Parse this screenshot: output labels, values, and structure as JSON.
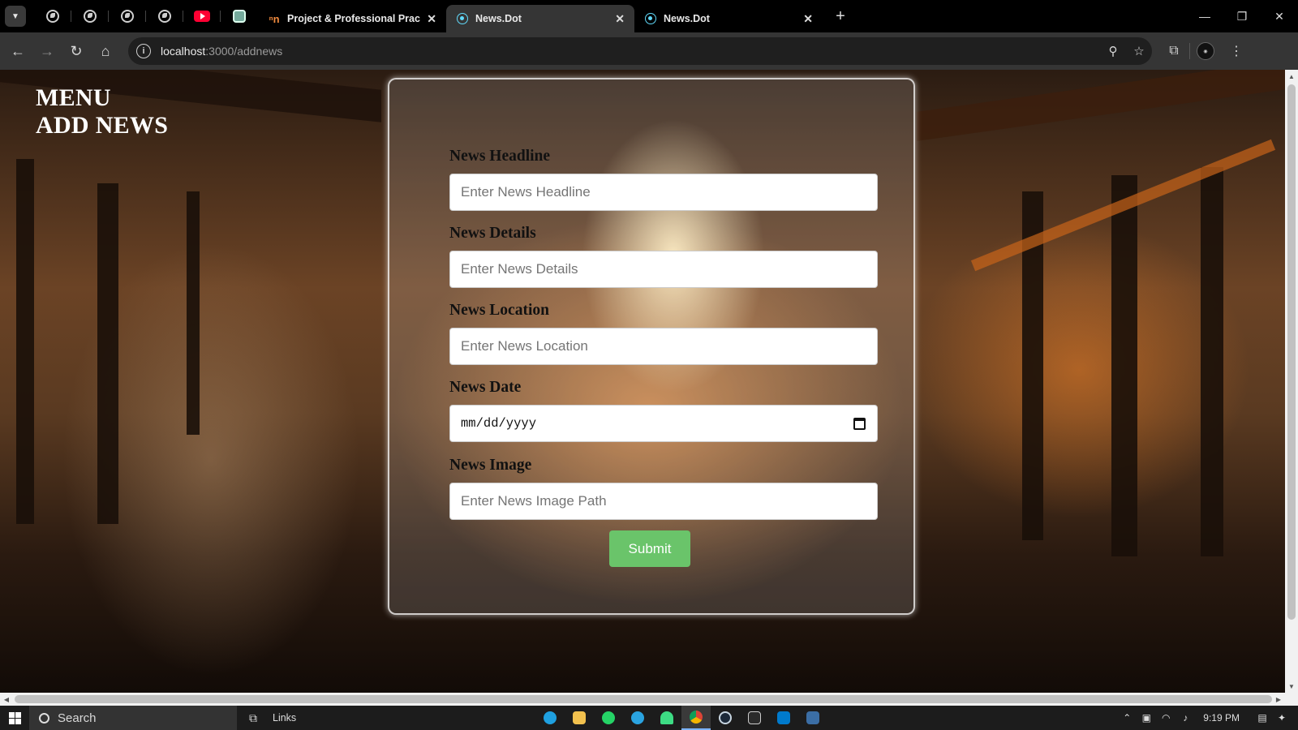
{
  "browser": {
    "tabs": [
      {
        "title": "Project & Professional Practice",
        "favicon": "tn-icon",
        "active": false
      },
      {
        "title": "News.Dot",
        "favicon": "react-icon",
        "active": true
      },
      {
        "title": "News.Dot",
        "favicon": "react-icon",
        "active": false
      }
    ],
    "address": {
      "host": "localhost",
      "path": ":3000/addnews"
    }
  },
  "page": {
    "nav": {
      "menu": "MENU",
      "add_news": "ADD NEWS"
    },
    "form": {
      "headline": {
        "label": "News Headline",
        "placeholder": "Enter News Headline"
      },
      "details": {
        "label": "News Details",
        "placeholder": "Enter News Details"
      },
      "location": {
        "label": "News Location",
        "placeholder": "Enter News Location"
      },
      "date": {
        "label": "News Date",
        "value": "mm/dd/yyyy"
      },
      "image": {
        "label": "News Image",
        "placeholder": "Enter News Image Path"
      },
      "submit": "Submit"
    },
    "colors": {
      "submit_bg": "#6ac46a",
      "card_border": "#ffffff"
    }
  },
  "taskbar": {
    "search": "Search",
    "links": "Links",
    "time": "9:19 PM"
  }
}
